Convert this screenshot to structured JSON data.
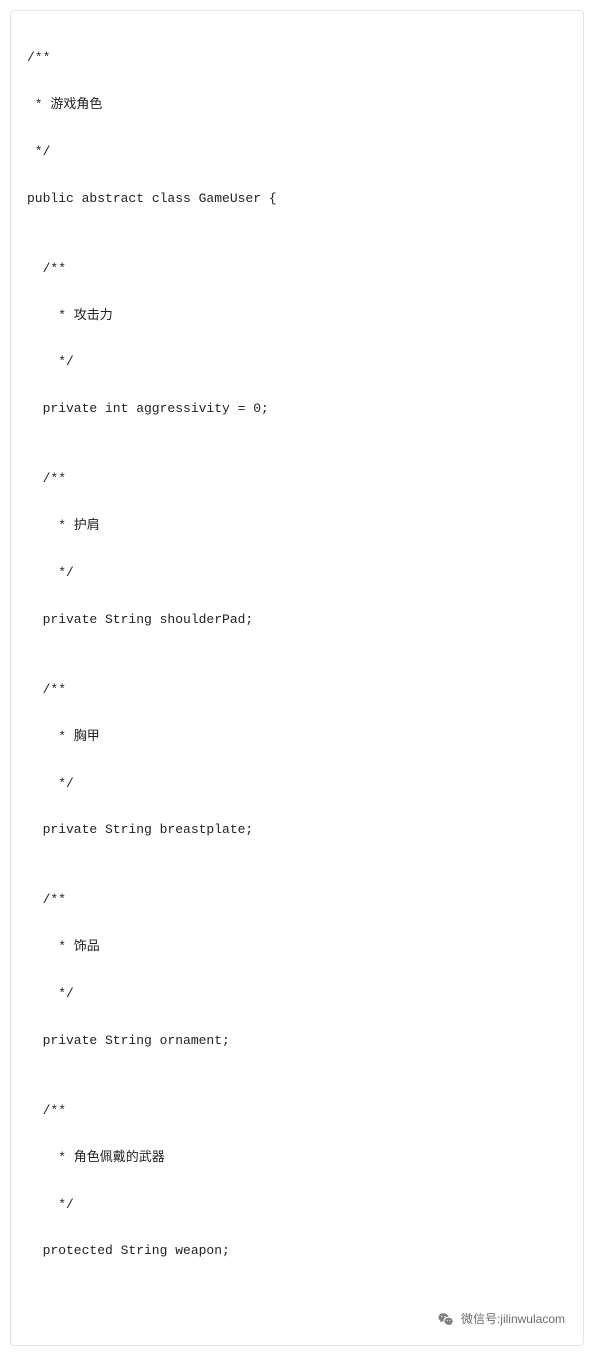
{
  "code": {
    "l1": "/**",
    "l2": " * 游戏角色",
    "l3": " */",
    "l4": "public abstract class GameUser {",
    "l5": "",
    "l6": "/**",
    "l7": " * 攻击力",
    "l8": " */",
    "l9": "private int aggressivity = 0;",
    "l10": "",
    "l11": "/**",
    "l12": " * 护肩",
    "l13": " */",
    "l14": "private String shoulderPad;",
    "l15": "",
    "l16": "/**",
    "l17": " * 胸甲",
    "l18": " */",
    "l19": "private String breastplate;",
    "l20": "",
    "l21": "/**",
    "l22": " * 饰品",
    "l23": " */",
    "l24": "private String ornament;",
    "l25": "",
    "l26": "/**",
    "l27": " * 角色佩戴的武器",
    "l28": " */",
    "l29": "protected String weapon;"
  },
  "watermark": {
    "text": "微信号:jilinwulacom"
  }
}
